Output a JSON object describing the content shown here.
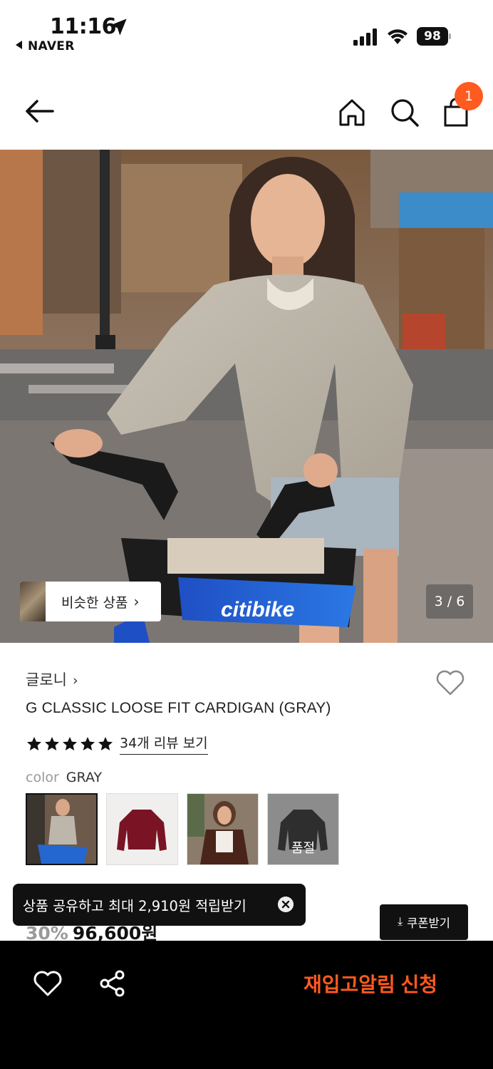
{
  "status_bar": {
    "time": "11:16",
    "back_app": "NAVER",
    "battery": "98"
  },
  "icons": {
    "location": "location-arrow-icon",
    "signal": "cellular-signal-icon",
    "wifi": "wifi-icon",
    "back": "arrow-left-icon",
    "home": "home-icon",
    "search": "search-icon",
    "bag": "shopping-bag-icon",
    "heart": "heart-icon",
    "share": "share-icon",
    "close": "close-icon",
    "download": "download-icon",
    "star": "star-icon",
    "chevron": "chevron-right-icon"
  },
  "header": {
    "cart_count": "1"
  },
  "hero": {
    "similar_label": "비슷한 상품",
    "similar_chevron": "›",
    "page_indicator": "3 / 6",
    "bike_brand": "citibike"
  },
  "product": {
    "brand": "글로니",
    "brand_chevron": "›",
    "title": "G CLASSIC LOOSE FIT CARDIGAN (GRAY)",
    "rating_stars": 5,
    "review_link": "34개 리뷰 보기",
    "color_label": "color",
    "color_value": "GRAY",
    "swatches": [
      {
        "name": "gray",
        "selected": true,
        "sold_out": false
      },
      {
        "name": "burgundy",
        "selected": false,
        "sold_out": false
      },
      {
        "name": "brown",
        "selected": false,
        "sold_out": false
      },
      {
        "name": "black",
        "selected": false,
        "sold_out": true
      }
    ],
    "sold_out_label": "품절",
    "discount": "30%",
    "price": "96,600원"
  },
  "toast": {
    "text": "상품 공유하고 최대 2,910원 적립받기"
  },
  "coupon": {
    "label": "쿠폰받기",
    "icon_glyph": "⤓"
  },
  "bottom_bar": {
    "restock_label": "재입고알림 신청"
  },
  "colors": {
    "accent": "#ff5a1f",
    "dark": "#000000",
    "muted": "#999999"
  }
}
